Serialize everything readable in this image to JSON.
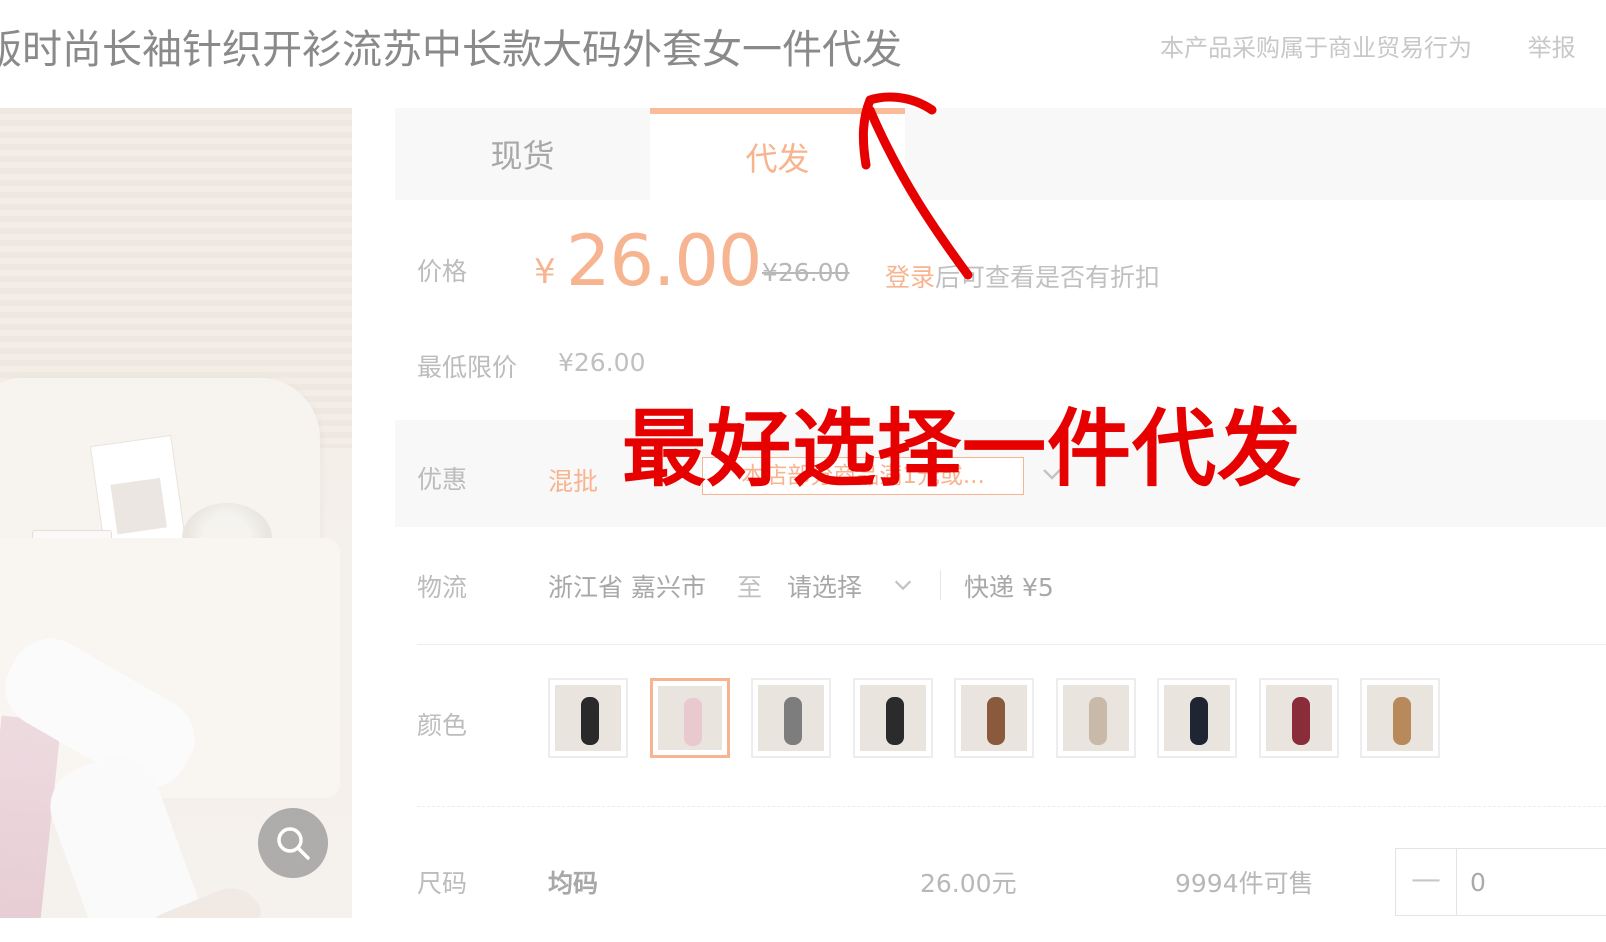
{
  "header": {
    "product_title": "版时尚长袖针织开衫流苏中长款大码外套女一件代发",
    "b2b_notice": "本产品采购属于商业贸易行为",
    "report_label": "举报"
  },
  "tabs": [
    {
      "label": "现货",
      "active": false
    },
    {
      "label": "代发",
      "active": true
    }
  ],
  "price": {
    "label": "价格",
    "currency": "¥",
    "value": "26.00",
    "original": "¥26.00",
    "login_link": "登录",
    "login_tip": "后可查看是否有折扣"
  },
  "min_price": {
    "label": "最低限价",
    "value": "¥26.00"
  },
  "promotion": {
    "label": "优惠",
    "mixed_batch": "混批",
    "coupon": "本店部分商品满1元或..."
  },
  "logistics": {
    "label": "物流",
    "from": "浙江省 嘉兴市",
    "to_label": "至",
    "to_select": "请选择",
    "shipping": "快递 ¥5"
  },
  "colors": {
    "label": "颜色",
    "selected_index": 1,
    "swatch_tones": [
      "#2a2a2a",
      "#e9c9cf",
      "#7d7d7d",
      "#2b2b2b",
      "#8a5a3c",
      "#c9b9a8",
      "#1f2533",
      "#8b2c3b",
      "#b8895a"
    ]
  },
  "size": {
    "label": "尺码",
    "value": "均码",
    "price": "26.00元",
    "stock": "9994件可售",
    "quantity": "0"
  },
  "annotation": {
    "text": "最好选择一件代发",
    "color": "#e60000"
  },
  "accent_color": "#f7b491"
}
